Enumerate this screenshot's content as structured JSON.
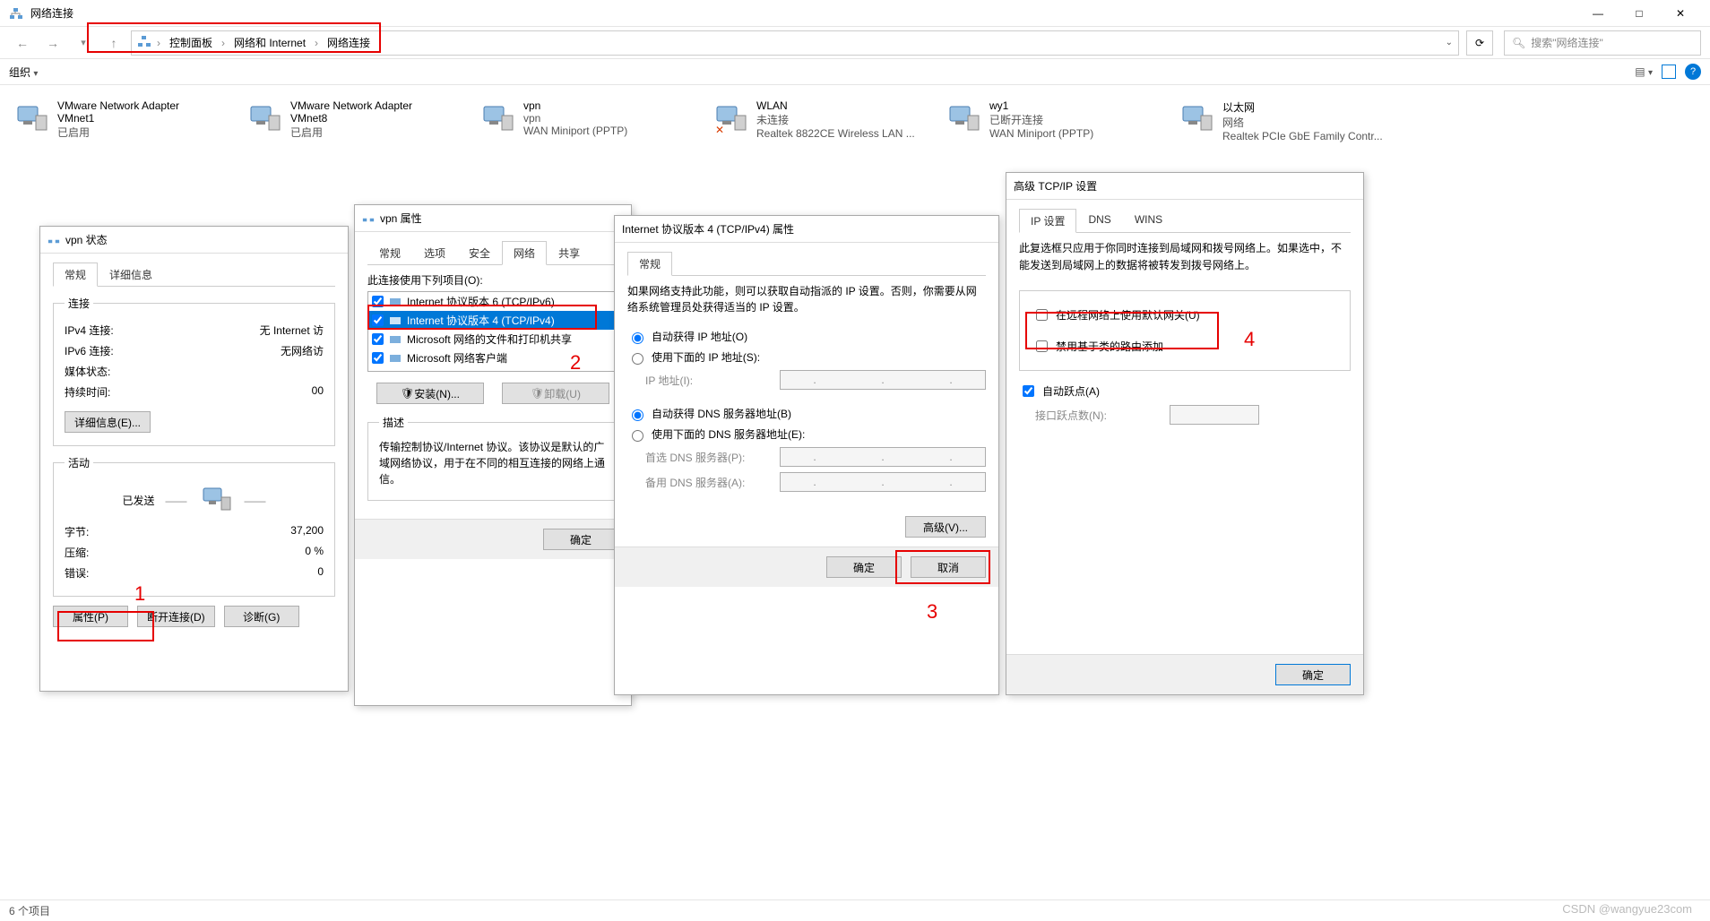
{
  "window": {
    "title": "网络连接",
    "breadcrumb": [
      "控制面板",
      "网络和 Internet",
      "网络连接"
    ],
    "search_placeholder": "搜索\"网络连接\"",
    "organize_label": "组织",
    "status_text": "6 个项目"
  },
  "adapters": [
    {
      "name": "VMware Network Adapter VMnet1",
      "sub1": "已启用",
      "sub2": ""
    },
    {
      "name": "VMware Network Adapter VMnet8",
      "sub1": "已启用",
      "sub2": ""
    },
    {
      "name": "vpn",
      "sub1": "vpn",
      "sub2": "WAN Miniport (PPTP)"
    },
    {
      "name": "WLAN",
      "sub1": "未连接",
      "sub2": "Realtek 8822CE Wireless LAN ...",
      "disconnected": true
    },
    {
      "name": "wy1",
      "sub1": "已断开连接",
      "sub2": "WAN Miniport (PPTP)"
    },
    {
      "name": "以太网",
      "sub1": "网络",
      "sub2": "Realtek PCIe GbE Family Contr..."
    }
  ],
  "dlg_status": {
    "title": "vpn 状态",
    "tabs": [
      "常规",
      "详细信息"
    ],
    "group_conn": "连接",
    "rows": {
      "ipv4_label": "IPv4 连接:",
      "ipv4_value": "无 Internet 访",
      "ipv6_label": "IPv6 连接:",
      "ipv6_value": "无网络访",
      "media_label": "媒体状态:",
      "media_value": "",
      "duration_label": "持续时间:",
      "duration_value": "00"
    },
    "details_btn": "详细信息(E)...",
    "group_act": "活动",
    "sent_label": "已发送",
    "act_rows": {
      "bytes_label": "字节:",
      "bytes_value": "37,200",
      "compress_label": "压缩:",
      "compress_value": "0 %",
      "errors_label": "错误:",
      "errors_value": "0"
    },
    "btn_props": "属性(P)",
    "btn_disconnect": "断开连接(D)",
    "btn_diag": "诊断(G)"
  },
  "dlg_props": {
    "title": "vpn 属性",
    "tabs": [
      "常规",
      "选项",
      "安全",
      "网络",
      "共享"
    ],
    "list_label": "此连接使用下列项目(O):",
    "items": [
      {
        "label": "Internet 协议版本 6 (TCP/IPv6)",
        "checked": true
      },
      {
        "label": "Internet 协议版本 4 (TCP/IPv4)",
        "checked": true,
        "selected": true
      },
      {
        "label": "Microsoft 网络的文件和打印机共享",
        "checked": true
      },
      {
        "label": "Microsoft 网络客户端",
        "checked": true
      }
    ],
    "btn_install": "安装(N)...",
    "btn_uninstall": "卸载(U)",
    "desc_label": "描述",
    "desc_text": "传输控制协议/Internet 协议。该协议是默认的广域网络协议，用于在不同的相互连接的网络上通信。",
    "btn_ok": "确定"
  },
  "dlg_ipv4": {
    "title": "Internet 协议版本 4 (TCP/IPv4) 属性",
    "tab": "常规",
    "intro": "如果网络支持此功能，则可以获取自动指派的 IP 设置。否则，你需要从网络系统管理员处获得适当的 IP 设置。",
    "r_auto_ip": "自动获得 IP 地址(O)",
    "r_manual_ip": "使用下面的 IP 地址(S):",
    "ip_label": "IP 地址(I):",
    "r_auto_dns": "自动获得 DNS 服务器地址(B)",
    "r_manual_dns": "使用下面的 DNS 服务器地址(E):",
    "dns1_label": "首选 DNS 服务器(P):",
    "dns2_label": "备用 DNS 服务器(A):",
    "btn_adv": "高级(V)...",
    "btn_ok": "确定",
    "btn_cancel": "取消"
  },
  "dlg_adv": {
    "title": "高级 TCP/IP 设置",
    "tabs": [
      "IP 设置",
      "DNS",
      "WINS"
    ],
    "note": "此复选框只应用于你同时连接到局域网和拨号网络上。如果选中，不能发送到局域网上的数据将被转发到拨号网络上。",
    "chk_gateway": "在远程网络上使用默认网关(U)",
    "chk_route": "禁用基于类的路由添加",
    "chk_hop": "自动跃点(A)",
    "hop_label": "接口跃点数(N):",
    "btn_ok": "确定"
  },
  "annotations": {
    "n1": "1",
    "n2": "2",
    "n3": "3",
    "n4": "4"
  },
  "watermark": "CSDN @wangyue23com"
}
